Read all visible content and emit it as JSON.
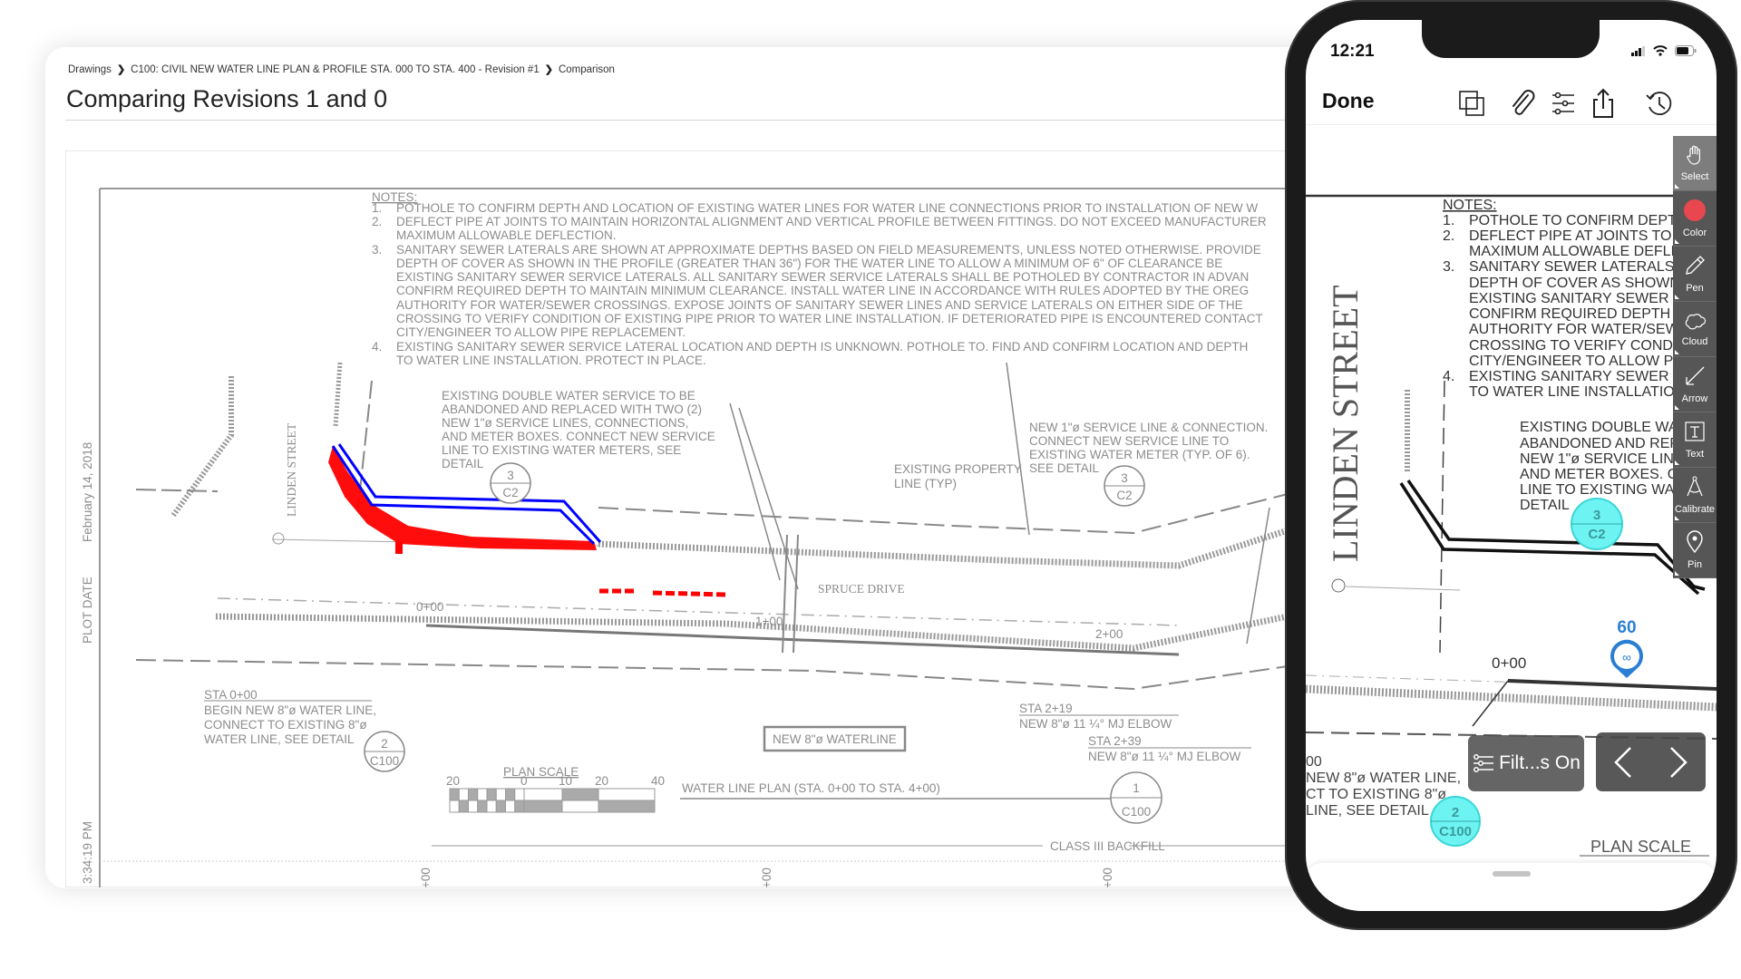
{
  "web": {
    "breadcrumb": [
      "Drawings",
      "C100: CIVIL NEW WATER LINE PLAN & PROFILE STA. 000 TO STA. 400 - Revision #1",
      "Comparison"
    ],
    "title": "Comparing Revisions 1 and 0"
  },
  "drawing": {
    "notes_heading": "NOTES:",
    "notes": [
      {
        "n": "1.",
        "text": "POTHOLE TO CONFIRM DEPTH AND LOCATION OF EXISTING WATER LINES FOR WATER LINE CONNECTIONS PRIOR TO INSTALLATION OF NEW W"
      },
      {
        "n": "2.",
        "text": "DEFLECT PIPE AT JOINTS TO MAINTAIN HORIZONTAL ALIGNMENT AND VERTICAL PROFILE BETWEEN FITTINGS.  DO NOT EXCEED MANUFACTURER"
      },
      {
        "n": "",
        "text": "MAXIMUM ALLOWABLE DEFLECTION."
      },
      {
        "n": "3.",
        "text": "SANITARY SEWER LATERALS ARE SHOWN AT APPROXIMATE DEPTHS BASED ON FIELD MEASUREMENTS, UNLESS NOTED OTHERWISE. PROVIDE"
      },
      {
        "n": "",
        "text": "DEPTH OF COVER AS SHOWN IN THE PROFILE (GREATER THAN 36\") FOR THE WATER LINE TO ALLOW A MINIMUM OF 6\" OF CLEARANCE BE"
      },
      {
        "n": "",
        "text": "EXISTING SANITARY SEWER SERVICE LATERALS.  ALL SANITARY SEWER SERVICE LATERALS SHALL BE POTHOLED BY CONTRACTOR IN ADVAN"
      },
      {
        "n": "",
        "text": "CONFIRM REQUIRED DEPTH TO MAINTAIN MINIMUM CLEARANCE.  INSTALL WATER LINE IN ACCORDANCE WITH RULES ADOPTED BY THE OREG"
      },
      {
        "n": "",
        "text": "AUTHORITY FOR WATER/SEWER CROSSINGS.  EXPOSE JOINTS OF SANITARY SEWER LINES AND SERVICE LATERALS ON EITHER SIDE OF THE"
      },
      {
        "n": "",
        "text": "CROSSING TO VERIFY CONDITION OF EXISTING PIPE PRIOR TO WATER LINE INSTALLATION. IF DETERIORATED PIPE IS ENCOUNTERED CONTACT"
      },
      {
        "n": "",
        "text": "CITY/ENGINEER TO ALLOW PIPE REPLACEMENT."
      },
      {
        "n": "4.",
        "text": "EXISTING SANITARY SEWER SERVICE LATERAL LOCATION AND DEPTH IS UNKNOWN. POTHOLE TO. FIND AND CONFIRM LOCATION AND DEPTH"
      },
      {
        "n": "",
        "text": "TO WATER LINE INSTALLATION.  PROTECT IN PLACE."
      }
    ],
    "linden_street": "LINDEN STREET",
    "spruce_drive": "SPRUCE DRIVE",
    "plot_date_label": "PLOT DATE",
    "plot_date": "February 14, 2018",
    "plot_time": "3:34:19 PM",
    "double_service_note": [
      "EXISTING DOUBLE WATER SERVICE TO BE",
      "ABANDONED AND REPLACED WITH TWO (2)",
      "NEW 1\"ø SERVICE LINES, CONNECTIONS,",
      "AND METER BOXES. CONNECT NEW SERVICE",
      "LINE TO EXISTING WATER METERS, SEE",
      "DETAIL"
    ],
    "service_line_note": [
      "NEW 1\"ø SERVICE LINE & CONNECTION.",
      "CONNECT NEW SERVICE LINE TO",
      "EXISTING WATER METER (TYP. OF 6).",
      "SEE DETAIL"
    ],
    "property_line_note": [
      "EXISTING PROPERTY",
      "LINE (TYP)"
    ],
    "detail_3_c2": {
      "top": "3",
      "bottom": "C2"
    },
    "detail_2_c100": {
      "top": "2",
      "bottom": "C100"
    },
    "detail_1_c100": {
      "top": "1",
      "bottom": "C100"
    },
    "stations": [
      "0+00",
      "1+00",
      "2+00"
    ],
    "sta_0_note": [
      "STA 0+00",
      "BEGIN NEW 8\"ø WATER LINE,",
      "CONNECT TO EXISTING 8\"ø",
      "WATER LINE, SEE DETAIL"
    ],
    "waterline_box": "NEW 8\"ø WATERLINE",
    "sta_219": [
      "STA 2+19",
      "NEW 8\"ø 11 ¼° MJ ELBOW"
    ],
    "sta_239": [
      "STA 2+39",
      "NEW 8\"ø 11 ¼° MJ ELBOW"
    ],
    "plan_scale": "PLAN SCALE",
    "scale_ticks": [
      "20",
      "0",
      "10",
      "20",
      "40"
    ],
    "plan_title": "WATER LINE PLAN (STA. 0+00 TO STA. 4+00)",
    "backfill": "CLASS III BACKFILL",
    "profile_stations": [
      "+00",
      "+00",
      "+00"
    ],
    "markup_colors": {
      "removed": "#ff0000",
      "added": "#0000ff"
    }
  },
  "phone": {
    "time": "12:21",
    "done": "Done",
    "toolbar_icons": [
      "compare-overlay-icon",
      "paperclip-icon",
      "sliders-icon",
      "share-icon",
      "history-icon"
    ],
    "tools": [
      {
        "label": "Select",
        "icon": "hand-icon",
        "active": true
      },
      {
        "label": "Color",
        "icon": "color-dot-icon",
        "color": "#e8474f"
      },
      {
        "label": "Pen",
        "icon": "pen-icon"
      },
      {
        "label": "Cloud",
        "icon": "cloud-icon"
      },
      {
        "label": "Arrow",
        "icon": "arrow-icon"
      },
      {
        "label": "Text",
        "icon": "text-icon"
      },
      {
        "label": "Calibrate",
        "icon": "compass-icon"
      },
      {
        "label": "Pin",
        "icon": "pin-icon"
      }
    ],
    "pin_count": "60",
    "station": "0+00",
    "sta_fragment": [
      "00",
      "NEW 8\"ø WATER LINE,",
      "CT TO EXISTING 8\"ø",
      "LINE, SEE DETAIL"
    ],
    "filters_label": "Filt...s On",
    "highlight_color": "#6ef3f3",
    "pin_color": "#2a7fd4"
  }
}
